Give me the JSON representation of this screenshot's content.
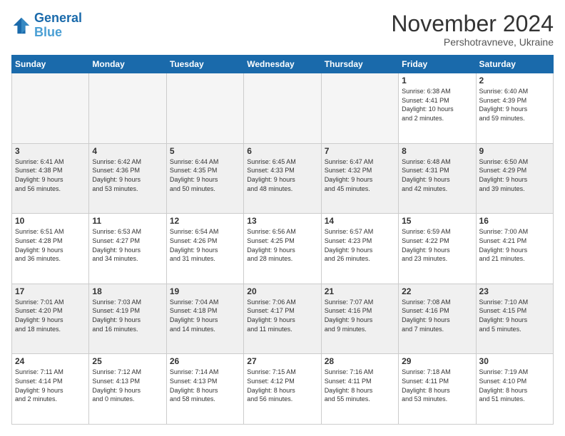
{
  "logo": {
    "line1": "General",
    "line2": "Blue"
  },
  "title": "November 2024",
  "subtitle": "Pershotravneve, Ukraine",
  "days_header": [
    "Sunday",
    "Monday",
    "Tuesday",
    "Wednesday",
    "Thursday",
    "Friday",
    "Saturday"
  ],
  "weeks": [
    {
      "cells": [
        {
          "day": "",
          "detail": "",
          "empty": true
        },
        {
          "day": "",
          "detail": "",
          "empty": true
        },
        {
          "day": "",
          "detail": "",
          "empty": true
        },
        {
          "day": "",
          "detail": "",
          "empty": true
        },
        {
          "day": "",
          "detail": "",
          "empty": true
        },
        {
          "day": "1",
          "detail": "Sunrise: 6:38 AM\nSunset: 4:41 PM\nDaylight: 10 hours\nand 2 minutes."
        },
        {
          "day": "2",
          "detail": "Sunrise: 6:40 AM\nSunset: 4:39 PM\nDaylight: 9 hours\nand 59 minutes."
        }
      ]
    },
    {
      "cells": [
        {
          "day": "3",
          "detail": "Sunrise: 6:41 AM\nSunset: 4:38 PM\nDaylight: 9 hours\nand 56 minutes."
        },
        {
          "day": "4",
          "detail": "Sunrise: 6:42 AM\nSunset: 4:36 PM\nDaylight: 9 hours\nand 53 minutes."
        },
        {
          "day": "5",
          "detail": "Sunrise: 6:44 AM\nSunset: 4:35 PM\nDaylight: 9 hours\nand 50 minutes."
        },
        {
          "day": "6",
          "detail": "Sunrise: 6:45 AM\nSunset: 4:33 PM\nDaylight: 9 hours\nand 48 minutes."
        },
        {
          "day": "7",
          "detail": "Sunrise: 6:47 AM\nSunset: 4:32 PM\nDaylight: 9 hours\nand 45 minutes."
        },
        {
          "day": "8",
          "detail": "Sunrise: 6:48 AM\nSunset: 4:31 PM\nDaylight: 9 hours\nand 42 minutes."
        },
        {
          "day": "9",
          "detail": "Sunrise: 6:50 AM\nSunset: 4:29 PM\nDaylight: 9 hours\nand 39 minutes."
        }
      ]
    },
    {
      "cells": [
        {
          "day": "10",
          "detail": "Sunrise: 6:51 AM\nSunset: 4:28 PM\nDaylight: 9 hours\nand 36 minutes."
        },
        {
          "day": "11",
          "detail": "Sunrise: 6:53 AM\nSunset: 4:27 PM\nDaylight: 9 hours\nand 34 minutes."
        },
        {
          "day": "12",
          "detail": "Sunrise: 6:54 AM\nSunset: 4:26 PM\nDaylight: 9 hours\nand 31 minutes."
        },
        {
          "day": "13",
          "detail": "Sunrise: 6:56 AM\nSunset: 4:25 PM\nDaylight: 9 hours\nand 28 minutes."
        },
        {
          "day": "14",
          "detail": "Sunrise: 6:57 AM\nSunset: 4:23 PM\nDaylight: 9 hours\nand 26 minutes."
        },
        {
          "day": "15",
          "detail": "Sunrise: 6:59 AM\nSunset: 4:22 PM\nDaylight: 9 hours\nand 23 minutes."
        },
        {
          "day": "16",
          "detail": "Sunrise: 7:00 AM\nSunset: 4:21 PM\nDaylight: 9 hours\nand 21 minutes."
        }
      ]
    },
    {
      "cells": [
        {
          "day": "17",
          "detail": "Sunrise: 7:01 AM\nSunset: 4:20 PM\nDaylight: 9 hours\nand 18 minutes."
        },
        {
          "day": "18",
          "detail": "Sunrise: 7:03 AM\nSunset: 4:19 PM\nDaylight: 9 hours\nand 16 minutes."
        },
        {
          "day": "19",
          "detail": "Sunrise: 7:04 AM\nSunset: 4:18 PM\nDaylight: 9 hours\nand 14 minutes."
        },
        {
          "day": "20",
          "detail": "Sunrise: 7:06 AM\nSunset: 4:17 PM\nDaylight: 9 hours\nand 11 minutes."
        },
        {
          "day": "21",
          "detail": "Sunrise: 7:07 AM\nSunset: 4:16 PM\nDaylight: 9 hours\nand 9 minutes."
        },
        {
          "day": "22",
          "detail": "Sunrise: 7:08 AM\nSunset: 4:16 PM\nDaylight: 9 hours\nand 7 minutes."
        },
        {
          "day": "23",
          "detail": "Sunrise: 7:10 AM\nSunset: 4:15 PM\nDaylight: 9 hours\nand 5 minutes."
        }
      ]
    },
    {
      "cells": [
        {
          "day": "24",
          "detail": "Sunrise: 7:11 AM\nSunset: 4:14 PM\nDaylight: 9 hours\nand 2 minutes."
        },
        {
          "day": "25",
          "detail": "Sunrise: 7:12 AM\nSunset: 4:13 PM\nDaylight: 9 hours\nand 0 minutes."
        },
        {
          "day": "26",
          "detail": "Sunrise: 7:14 AM\nSunset: 4:13 PM\nDaylight: 8 hours\nand 58 minutes."
        },
        {
          "day": "27",
          "detail": "Sunrise: 7:15 AM\nSunset: 4:12 PM\nDaylight: 8 hours\nand 56 minutes."
        },
        {
          "day": "28",
          "detail": "Sunrise: 7:16 AM\nSunset: 4:11 PM\nDaylight: 8 hours\nand 55 minutes."
        },
        {
          "day": "29",
          "detail": "Sunrise: 7:18 AM\nSunset: 4:11 PM\nDaylight: 8 hours\nand 53 minutes."
        },
        {
          "day": "30",
          "detail": "Sunrise: 7:19 AM\nSunset: 4:10 PM\nDaylight: 8 hours\nand 51 minutes."
        }
      ]
    }
  ]
}
